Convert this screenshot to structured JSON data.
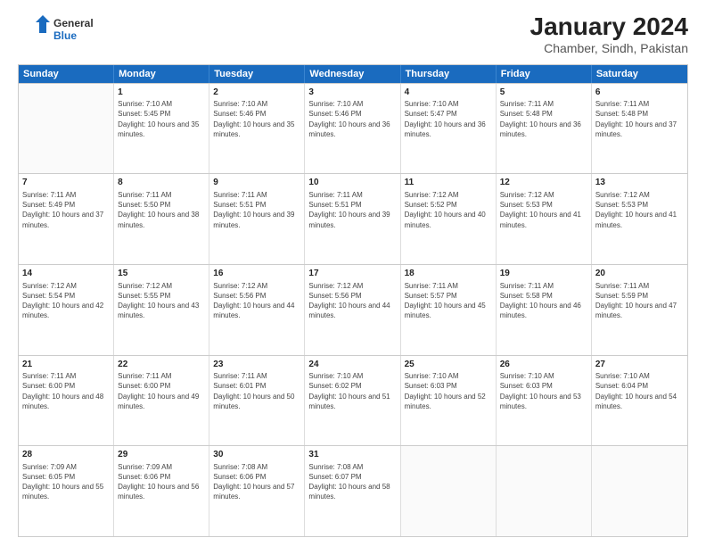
{
  "logo": {
    "general": "General",
    "blue": "Blue"
  },
  "title": "January 2024",
  "subtitle": "Chamber, Sindh, Pakistan",
  "days": [
    "Sunday",
    "Monday",
    "Tuesday",
    "Wednesday",
    "Thursday",
    "Friday",
    "Saturday"
  ],
  "weeks": [
    [
      {
        "day": "",
        "sunrise": "",
        "sunset": "",
        "daylight": ""
      },
      {
        "day": "1",
        "sunrise": "Sunrise: 7:10 AM",
        "sunset": "Sunset: 5:45 PM",
        "daylight": "Daylight: 10 hours and 35 minutes."
      },
      {
        "day": "2",
        "sunrise": "Sunrise: 7:10 AM",
        "sunset": "Sunset: 5:46 PM",
        "daylight": "Daylight: 10 hours and 35 minutes."
      },
      {
        "day": "3",
        "sunrise": "Sunrise: 7:10 AM",
        "sunset": "Sunset: 5:46 PM",
        "daylight": "Daylight: 10 hours and 36 minutes."
      },
      {
        "day": "4",
        "sunrise": "Sunrise: 7:10 AM",
        "sunset": "Sunset: 5:47 PM",
        "daylight": "Daylight: 10 hours and 36 minutes."
      },
      {
        "day": "5",
        "sunrise": "Sunrise: 7:11 AM",
        "sunset": "Sunset: 5:48 PM",
        "daylight": "Daylight: 10 hours and 36 minutes."
      },
      {
        "day": "6",
        "sunrise": "Sunrise: 7:11 AM",
        "sunset": "Sunset: 5:48 PM",
        "daylight": "Daylight: 10 hours and 37 minutes."
      }
    ],
    [
      {
        "day": "7",
        "sunrise": "Sunrise: 7:11 AM",
        "sunset": "Sunset: 5:49 PM",
        "daylight": "Daylight: 10 hours and 37 minutes."
      },
      {
        "day": "8",
        "sunrise": "Sunrise: 7:11 AM",
        "sunset": "Sunset: 5:50 PM",
        "daylight": "Daylight: 10 hours and 38 minutes."
      },
      {
        "day": "9",
        "sunrise": "Sunrise: 7:11 AM",
        "sunset": "Sunset: 5:51 PM",
        "daylight": "Daylight: 10 hours and 39 minutes."
      },
      {
        "day": "10",
        "sunrise": "Sunrise: 7:11 AM",
        "sunset": "Sunset: 5:51 PM",
        "daylight": "Daylight: 10 hours and 39 minutes."
      },
      {
        "day": "11",
        "sunrise": "Sunrise: 7:12 AM",
        "sunset": "Sunset: 5:52 PM",
        "daylight": "Daylight: 10 hours and 40 minutes."
      },
      {
        "day": "12",
        "sunrise": "Sunrise: 7:12 AM",
        "sunset": "Sunset: 5:53 PM",
        "daylight": "Daylight: 10 hours and 41 minutes."
      },
      {
        "day": "13",
        "sunrise": "Sunrise: 7:12 AM",
        "sunset": "Sunset: 5:53 PM",
        "daylight": "Daylight: 10 hours and 41 minutes."
      }
    ],
    [
      {
        "day": "14",
        "sunrise": "Sunrise: 7:12 AM",
        "sunset": "Sunset: 5:54 PM",
        "daylight": "Daylight: 10 hours and 42 minutes."
      },
      {
        "day": "15",
        "sunrise": "Sunrise: 7:12 AM",
        "sunset": "Sunset: 5:55 PM",
        "daylight": "Daylight: 10 hours and 43 minutes."
      },
      {
        "day": "16",
        "sunrise": "Sunrise: 7:12 AM",
        "sunset": "Sunset: 5:56 PM",
        "daylight": "Daylight: 10 hours and 44 minutes."
      },
      {
        "day": "17",
        "sunrise": "Sunrise: 7:12 AM",
        "sunset": "Sunset: 5:56 PM",
        "daylight": "Daylight: 10 hours and 44 minutes."
      },
      {
        "day": "18",
        "sunrise": "Sunrise: 7:11 AM",
        "sunset": "Sunset: 5:57 PM",
        "daylight": "Daylight: 10 hours and 45 minutes."
      },
      {
        "day": "19",
        "sunrise": "Sunrise: 7:11 AM",
        "sunset": "Sunset: 5:58 PM",
        "daylight": "Daylight: 10 hours and 46 minutes."
      },
      {
        "day": "20",
        "sunrise": "Sunrise: 7:11 AM",
        "sunset": "Sunset: 5:59 PM",
        "daylight": "Daylight: 10 hours and 47 minutes."
      }
    ],
    [
      {
        "day": "21",
        "sunrise": "Sunrise: 7:11 AM",
        "sunset": "Sunset: 6:00 PM",
        "daylight": "Daylight: 10 hours and 48 minutes."
      },
      {
        "day": "22",
        "sunrise": "Sunrise: 7:11 AM",
        "sunset": "Sunset: 6:00 PM",
        "daylight": "Daylight: 10 hours and 49 minutes."
      },
      {
        "day": "23",
        "sunrise": "Sunrise: 7:11 AM",
        "sunset": "Sunset: 6:01 PM",
        "daylight": "Daylight: 10 hours and 50 minutes."
      },
      {
        "day": "24",
        "sunrise": "Sunrise: 7:10 AM",
        "sunset": "Sunset: 6:02 PM",
        "daylight": "Daylight: 10 hours and 51 minutes."
      },
      {
        "day": "25",
        "sunrise": "Sunrise: 7:10 AM",
        "sunset": "Sunset: 6:03 PM",
        "daylight": "Daylight: 10 hours and 52 minutes."
      },
      {
        "day": "26",
        "sunrise": "Sunrise: 7:10 AM",
        "sunset": "Sunset: 6:03 PM",
        "daylight": "Daylight: 10 hours and 53 minutes."
      },
      {
        "day": "27",
        "sunrise": "Sunrise: 7:10 AM",
        "sunset": "Sunset: 6:04 PM",
        "daylight": "Daylight: 10 hours and 54 minutes."
      }
    ],
    [
      {
        "day": "28",
        "sunrise": "Sunrise: 7:09 AM",
        "sunset": "Sunset: 6:05 PM",
        "daylight": "Daylight: 10 hours and 55 minutes."
      },
      {
        "day": "29",
        "sunrise": "Sunrise: 7:09 AM",
        "sunset": "Sunset: 6:06 PM",
        "daylight": "Daylight: 10 hours and 56 minutes."
      },
      {
        "day": "30",
        "sunrise": "Sunrise: 7:08 AM",
        "sunset": "Sunset: 6:06 PM",
        "daylight": "Daylight: 10 hours and 57 minutes."
      },
      {
        "day": "31",
        "sunrise": "Sunrise: 7:08 AM",
        "sunset": "Sunset: 6:07 PM",
        "daylight": "Daylight: 10 hours and 58 minutes."
      },
      {
        "day": "",
        "sunrise": "",
        "sunset": "",
        "daylight": ""
      },
      {
        "day": "",
        "sunrise": "",
        "sunset": "",
        "daylight": ""
      },
      {
        "day": "",
        "sunrise": "",
        "sunset": "",
        "daylight": ""
      }
    ]
  ]
}
